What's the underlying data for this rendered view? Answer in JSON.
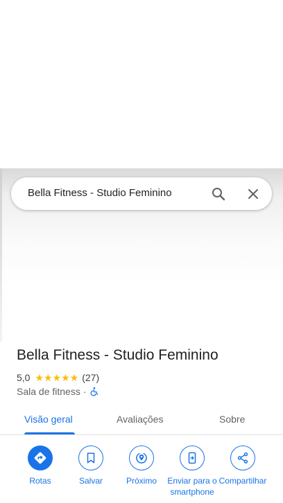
{
  "search": {
    "query": "Bella Fitness - Studio Feminino"
  },
  "place": {
    "name": "Bella Fitness - Studio Feminino",
    "rating": "5,0",
    "stars": "★★★★★",
    "review_count": "(27)",
    "category": "Sala de fitness",
    "separator": "·"
  },
  "tabs": [
    {
      "label": "Visão geral",
      "active": true
    },
    {
      "label": "Avaliações",
      "active": false
    },
    {
      "label": "Sobre",
      "active": false
    }
  ],
  "actions": [
    {
      "label": "Rotas",
      "icon": "directions-icon"
    },
    {
      "label": "Salvar",
      "icon": "bookmark-icon"
    },
    {
      "label": "Próximo",
      "icon": "nearby-icon"
    },
    {
      "label": "Enviar para o smartphone",
      "icon": "send-to-phone-icon"
    },
    {
      "label": "Compartilhar",
      "icon": "share-icon"
    }
  ],
  "colors": {
    "accent": "#1a73e8",
    "star": "#fbbc04",
    "text": "#202124",
    "secondary_text": "#5f6368"
  }
}
